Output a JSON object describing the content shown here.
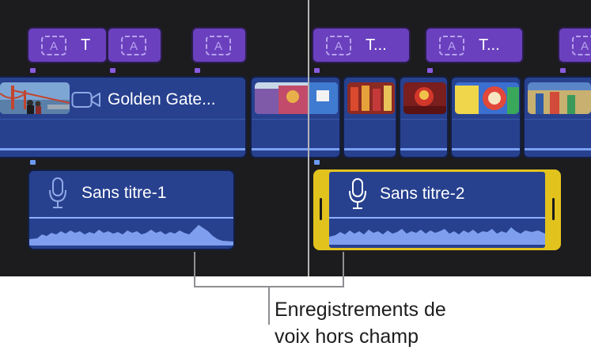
{
  "timeline": {
    "title_clips": [
      {
        "label": "T"
      },
      {
        "label": ""
      },
      {
        "label": ""
      },
      {
        "label": "T..."
      },
      {
        "label": "T..."
      },
      {
        "label": ""
      }
    ],
    "video_clips": [
      {
        "label": "Golden Gate..."
      }
    ],
    "audio_clips": [
      {
        "label": "Sans titre-1",
        "selected": false
      },
      {
        "label": "Sans titre-2",
        "selected": true
      }
    ]
  },
  "callout": {
    "line1": "Enregistrements de",
    "line2": "voix hors champ"
  },
  "colors": {
    "title_clip": "#6a40be",
    "video_clip": "#27418f",
    "selection": "#e2c31d",
    "connection_dot": "#6b9af0"
  },
  "icons": [
    "text-title-icon",
    "camera-icon",
    "microphone-icon"
  ]
}
